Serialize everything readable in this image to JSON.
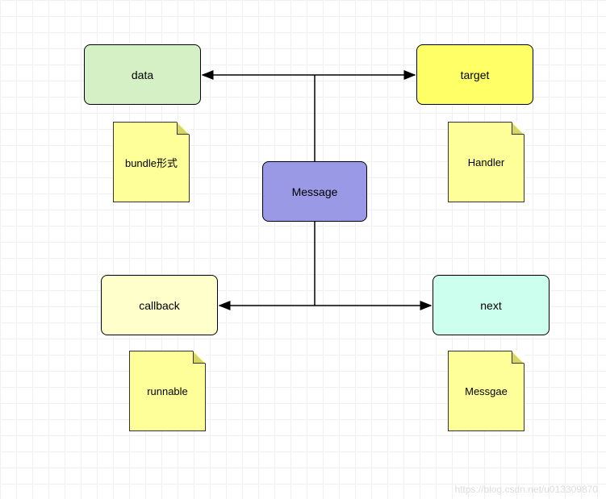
{
  "center": {
    "label": "Message"
  },
  "nodes": {
    "topLeft": {
      "label": "data"
    },
    "topRight": {
      "label": "target"
    },
    "bottomLeft": {
      "label": "callback"
    },
    "bottomRight": {
      "label": "next"
    }
  },
  "notes": {
    "topLeft": {
      "label": "bundle形式"
    },
    "topRight": {
      "label": "Handler"
    },
    "bottomLeft": {
      "label": "runnable"
    },
    "bottomRight": {
      "label": "Messgae"
    }
  },
  "colors": {
    "data": "#d4f0c4",
    "target": "#ffff66",
    "callback": "#ffffcc",
    "next": "#ccffee",
    "message": "#9999e6",
    "note": "#ffff99"
  },
  "watermark": "https://blog.csdn.net/u013309870"
}
